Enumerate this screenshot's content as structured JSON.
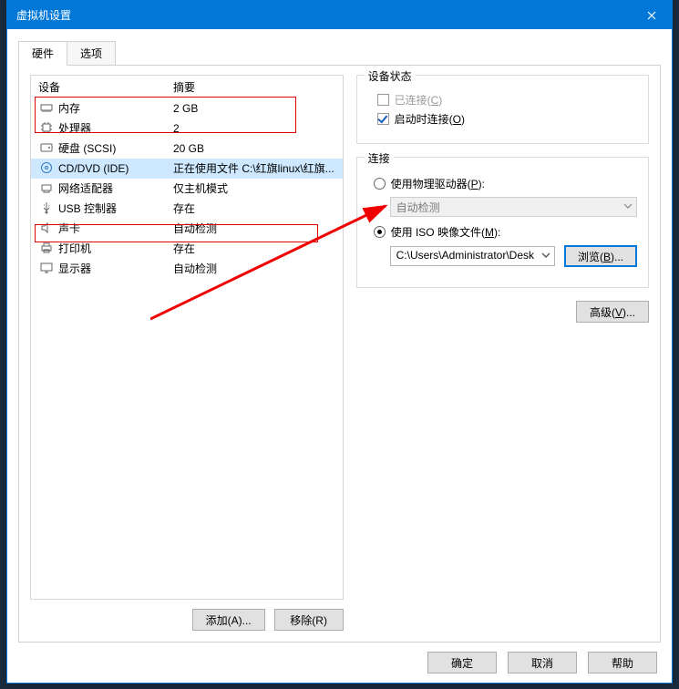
{
  "title": "虚拟机设置",
  "tabs": {
    "hardware": "硬件",
    "options": "选项"
  },
  "headers": {
    "device": "设备",
    "summary": "摘要"
  },
  "devices": [
    {
      "name": "内存",
      "summary": "2 GB"
    },
    {
      "name": "处理器",
      "summary": "2"
    },
    {
      "name": "硬盘 (SCSI)",
      "summary": "20 GB"
    },
    {
      "name": "CD/DVD (IDE)",
      "summary": "正在使用文件 C:\\红旗linux\\红旗..."
    },
    {
      "name": "网络适配器",
      "summary": "仅主机模式"
    },
    {
      "name": "USB 控制器",
      "summary": "存在"
    },
    {
      "name": "声卡",
      "summary": "自动检测"
    },
    {
      "name": "打印机",
      "summary": "存在"
    },
    {
      "name": "显示器",
      "summary": "自动检测"
    }
  ],
  "selected_index": 3,
  "left_buttons": {
    "add": "添加(A)...",
    "remove": "移除(R)"
  },
  "status": {
    "group_title": "设备状态",
    "connected_label": "已连接(C)",
    "connect_at_poweron_label": "启动时连接(O)"
  },
  "connection": {
    "group_title": "连接",
    "use_physical": "使用物理驱动器(P):",
    "physical_value": "自动检测",
    "use_iso": "使用 ISO 映像文件(M):",
    "iso_path": "C:\\Users\\Administrator\\Desk",
    "browse": "浏览(B)..."
  },
  "advanced": "高级(V)...",
  "footer": {
    "ok": "确定",
    "cancel": "取消",
    "help": "帮助"
  }
}
